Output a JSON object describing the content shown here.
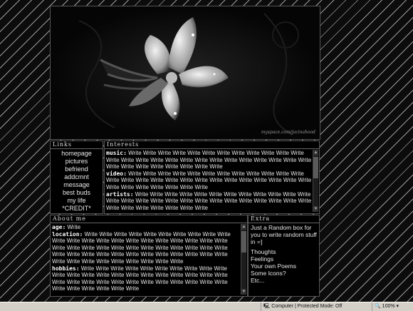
{
  "banner": {
    "watermark": "myspace.com/jacinahood"
  },
  "links": {
    "title": "Links",
    "items": [
      "homepage",
      "pictures",
      "befriend",
      "addcmnt",
      "message",
      "best buds",
      "my life",
      "*CREDIT*"
    ]
  },
  "interests": {
    "title": "Interests",
    "sections": [
      {
        "label": "music:",
        "text": "Write Write Write Write Write Write Write Write Write Write Write Write Write Write Write Write Write Write Write Write Write Write Write Write Write Write Write Write Write Write Write Write Write Write"
      },
      {
        "label": "video:",
        "text": "Write Write Write Write Write Write Write Write Write Write Write Write Write Write Write Write Write Write Write Write Write Write Write Write Write Write Write Write Write Write Write Write Write"
      },
      {
        "label": "artists:",
        "text": "Write Write Write Write Write Write Write Write Write Write Write Write Write Write Write Write Write Write Write Write Write Write Write Write Write Write Write Write Write Write Write Write Write"
      }
    ]
  },
  "about": {
    "title": "About me",
    "sections": [
      {
        "label": "age:",
        "text": "Write"
      },
      {
        "label": "location:",
        "text": "Write Write Write Write Write Write Write Write Write Write Write Write Write Write Write Write Write Write Write Write Write Write Write Write Write Write Write Write Write Write Write Write Write Write Write Write Write Write Write Write Write Write Write Write Write Write Write Write Write Write Write Write Write Write Write"
      },
      {
        "label": "hobbies:",
        "text": "Write Write Write Write Write Write Write Write Write Write Write Write Write Write Write Write Write Write Write Write Write Write Write Write Write Write Write Write Write Write Write Write Write Write Write Write Write Write Write Write"
      }
    ]
  },
  "extra": {
    "title": "Extra",
    "intro": "Just a Random box for you to write random stuff in =]",
    "items": [
      "Thoughts",
      "Feelings",
      "Your own Poems",
      "Some Icons?",
      "Etc..."
    ]
  },
  "statusbar": {
    "zone": "Computer | Protected Mode: Off",
    "zoom": "100%"
  }
}
